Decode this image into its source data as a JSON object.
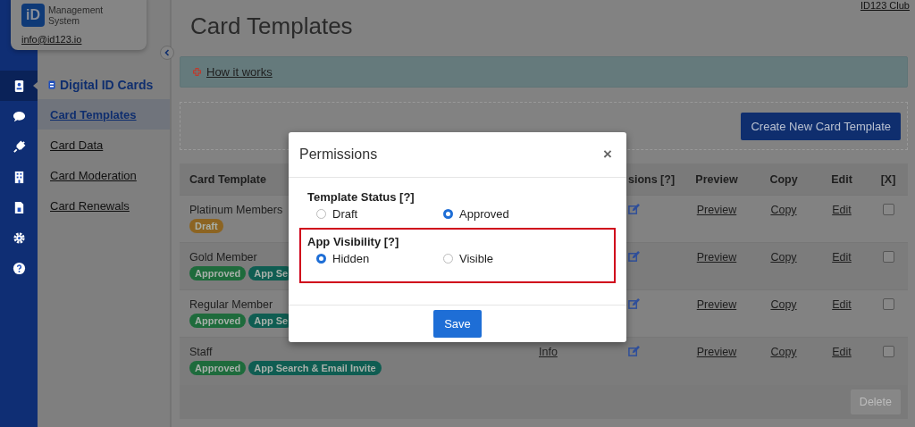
{
  "brand": {
    "logo": "iD",
    "line1": "Management",
    "line2": "System",
    "email": "info@id123.io"
  },
  "top_link": "ID123 Club",
  "rail": [
    {
      "kind": "badge",
      "selected": true
    },
    {
      "kind": "chat",
      "selected": false
    },
    {
      "kind": "plug",
      "selected": false
    },
    {
      "kind": "building",
      "selected": false
    },
    {
      "kind": "invoice",
      "selected": false
    },
    {
      "kind": "gear",
      "selected": false
    },
    {
      "kind": "help",
      "selected": false
    }
  ],
  "nav": {
    "heading": "Digital ID Cards",
    "items": [
      {
        "label": "Card Templates",
        "selected": true
      },
      {
        "label": "Card Data",
        "selected": false
      },
      {
        "label": "Card Moderation",
        "selected": false
      },
      {
        "label": "Card Renewals",
        "selected": false
      }
    ]
  },
  "page": {
    "title": "Card Templates",
    "help_link": "How it works",
    "create_button": "Create New Card Template"
  },
  "table": {
    "columns": [
      "Card Template",
      "",
      "sions [?]",
      "Preview",
      "Copy",
      "Edit",
      "[X]"
    ],
    "rows": [
      {
        "name": "Platinum Members",
        "tags": [
          {
            "label": "Draft",
            "color": "#8c6422"
          }
        ],
        "preview": "Preview",
        "copy": "Copy",
        "edit": "Edit",
        "checked": false
      },
      {
        "name": "Gold Member",
        "tags": [
          {
            "label": "Approved",
            "color": "#1e6b3c"
          },
          {
            "label": "App Se",
            "color": "#0f5d52"
          }
        ],
        "preview": "Preview",
        "copy": "Copy",
        "edit": "Edit",
        "checked": false
      },
      {
        "name": "Regular Member",
        "tags": [
          {
            "label": "Approved",
            "color": "#1e6b3c"
          },
          {
            "label": "App Se",
            "color": "#0f5d52"
          }
        ],
        "preview": "Preview",
        "copy": "Copy",
        "edit": "Edit",
        "checked": false
      },
      {
        "name": "Staff",
        "tags": [
          {
            "label": "Approved",
            "color": "#1e6b3c"
          },
          {
            "label": "App Search & Email Invite",
            "color": "#0f5d52"
          }
        ],
        "info": "Info",
        "preview": "Preview",
        "copy": "Copy",
        "edit": "Edit",
        "checked": false
      }
    ],
    "delete_button": {
      "label": "Delete",
      "disabled": true
    }
  },
  "modal": {
    "title": "Permissions",
    "close": "×",
    "sections": [
      {
        "title": "Template Status [?]",
        "highlighted": false,
        "options": [
          {
            "label": "Draft",
            "selected": false
          },
          {
            "label": "Approved",
            "selected": true
          }
        ]
      },
      {
        "title": "App Visibility [?]",
        "highlighted": true,
        "options": [
          {
            "label": "Hidden",
            "selected": true
          },
          {
            "label": "Visible",
            "selected": false
          }
        ]
      }
    ],
    "save_button": "Save"
  }
}
